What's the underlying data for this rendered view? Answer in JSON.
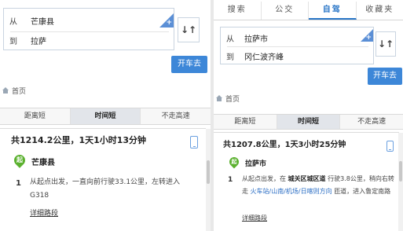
{
  "left": {
    "route": {
      "from_label": "从",
      "from_value": "芒康县",
      "to_label": "到",
      "to_value": "拉萨"
    },
    "go_label": "开车去",
    "home_label": "首页",
    "modes": [
      "距离短",
      "时间短",
      "不走高速"
    ],
    "summary": "共1214.2公里，1天1小时13分钟",
    "start_marker": "起",
    "start_name": "芒康县",
    "step": {
      "num": "1",
      "text": "从起点出发，一直向前行驶33.1公里，左转进入G318"
    },
    "detail_link": "详细路段"
  },
  "right": {
    "tabs": [
      "搜索",
      "公交",
      "自驾",
      "收藏夹"
    ],
    "route": {
      "from_label": "从",
      "from_value": "拉萨市",
      "to_label": "到",
      "to_value": "冈仁波齐峰"
    },
    "go_label": "开车去",
    "home_label": "首页",
    "modes": [
      "距离短",
      "时间短",
      "不走高速"
    ],
    "summary": "共1207.8公里，1天3小时25分钟",
    "start_marker": "起",
    "start_name": "拉萨市",
    "step": {
      "num": "1",
      "part1": "从起点出发，在",
      "bold1": "城关区城区道",
      "part2": "行驶3.8公里，稍向右转走",
      "highlight": "火车站/山南/机场/日喀则方向",
      "part3": "匝道，进入鲁定南路"
    },
    "detail_link": "详细路段"
  },
  "colors": {
    "accent": "#3d87d8",
    "start_marker": "#5bb12f",
    "active_tab": "#2a76c7"
  },
  "icons": [
    "add-waypoint-icon",
    "swap-icon",
    "home-icon",
    "phone-icon",
    "start-marker-icon"
  ]
}
